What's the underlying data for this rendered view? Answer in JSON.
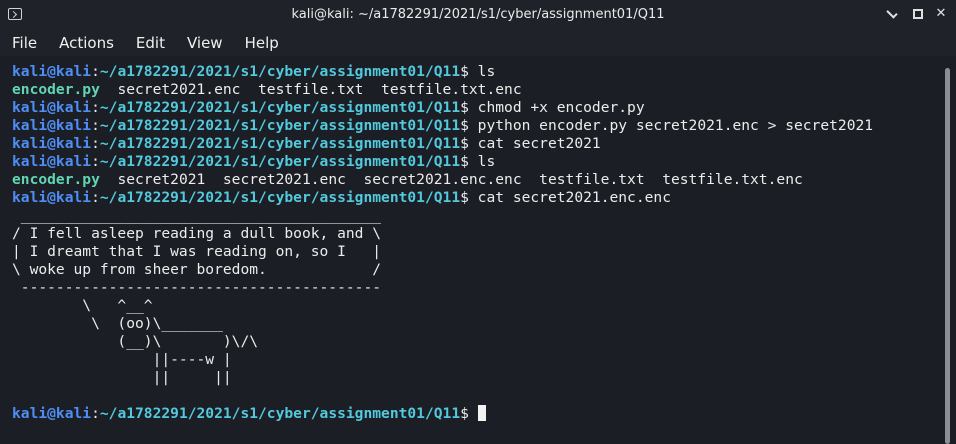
{
  "window": {
    "title": "kali@kali: ~/a1782291/2021/s1/cyber/assignment01/Q11"
  },
  "menu": {
    "items": [
      "File",
      "Actions",
      "Edit",
      "View",
      "Help"
    ]
  },
  "colors": {
    "background": "#1b1e24",
    "user": "#4e8ef5",
    "path": "#52c9dd",
    "executable": "#61d5b3",
    "text": "#ececec"
  },
  "terminal": {
    "lines": [
      [
        {
          "t": "kali@kali",
          "c": "user"
        },
        {
          "t": ":",
          "c": "plain"
        },
        {
          "t": "~/a1782291/2021/s1/cyber/assignment01/Q11",
          "c": "path"
        },
        {
          "t": "$ ls",
          "c": "plain"
        }
      ],
      [
        {
          "t": "encoder.py",
          "c": "exec"
        },
        {
          "t": "  secret2021.enc  testfile.txt  testfile.txt.enc",
          "c": "plain"
        }
      ],
      [
        {
          "t": "kali@kali",
          "c": "user"
        },
        {
          "t": ":",
          "c": "plain"
        },
        {
          "t": "~/a1782291/2021/s1/cyber/assignment01/Q11",
          "c": "path"
        },
        {
          "t": "$ chmod +x encoder.py",
          "c": "plain"
        }
      ],
      [
        {
          "t": "kali@kali",
          "c": "user"
        },
        {
          "t": ":",
          "c": "plain"
        },
        {
          "t": "~/a1782291/2021/s1/cyber/assignment01/Q11",
          "c": "path"
        },
        {
          "t": "$ python encoder.py secret2021.enc > secret2021",
          "c": "plain"
        }
      ],
      [
        {
          "t": "kali@kali",
          "c": "user"
        },
        {
          "t": ":",
          "c": "plain"
        },
        {
          "t": "~/a1782291/2021/s1/cyber/assignment01/Q11",
          "c": "path"
        },
        {
          "t": "$ cat secret2021",
          "c": "plain"
        }
      ],
      [
        {
          "t": "kali@kali",
          "c": "user"
        },
        {
          "t": ":",
          "c": "plain"
        },
        {
          "t": "~/a1782291/2021/s1/cyber/assignment01/Q11",
          "c": "path"
        },
        {
          "t": "$ ls",
          "c": "plain"
        }
      ],
      [
        {
          "t": "encoder.py",
          "c": "exec"
        },
        {
          "t": "  secret2021  secret2021.enc  secret2021.enc.enc  testfile.txt  testfile.txt.enc",
          "c": "plain"
        }
      ],
      [
        {
          "t": "kali@kali",
          "c": "user"
        },
        {
          "t": ":",
          "c": "plain"
        },
        {
          "t": "~/a1782291/2021/s1/cyber/assignment01/Q11",
          "c": "path"
        },
        {
          "t": "$ cat secret2021.enc.enc",
          "c": "plain"
        }
      ],
      [
        {
          "t": " _________________________________________",
          "c": "plain"
        }
      ],
      [
        {
          "t": "/ I fell asleep reading a dull book, and \\",
          "c": "plain"
        }
      ],
      [
        {
          "t": "| I dreamt that I was reading on, so I   |",
          "c": "plain"
        }
      ],
      [
        {
          "t": "\\ woke up from sheer boredom.            /",
          "c": "plain"
        }
      ],
      [
        {
          "t": " -----------------------------------------",
          "c": "plain"
        }
      ],
      [
        {
          "t": "        \\   ^__^",
          "c": "plain"
        }
      ],
      [
        {
          "t": "         \\  (oo)\\_______",
          "c": "plain"
        }
      ],
      [
        {
          "t": "            (__)\\       )\\/\\",
          "c": "plain"
        }
      ],
      [
        {
          "t": "                ||----w |",
          "c": "plain"
        }
      ],
      [
        {
          "t": "                ||     ||",
          "c": "plain"
        }
      ],
      [
        {
          "t": "",
          "c": "plain"
        }
      ],
      [
        {
          "t": "kali@kali",
          "c": "user"
        },
        {
          "t": ":",
          "c": "plain"
        },
        {
          "t": "~/a1782291/2021/s1/cyber/assignment01/Q11",
          "c": "path"
        },
        {
          "t": "$ ",
          "c": "plain"
        }
      ]
    ]
  }
}
